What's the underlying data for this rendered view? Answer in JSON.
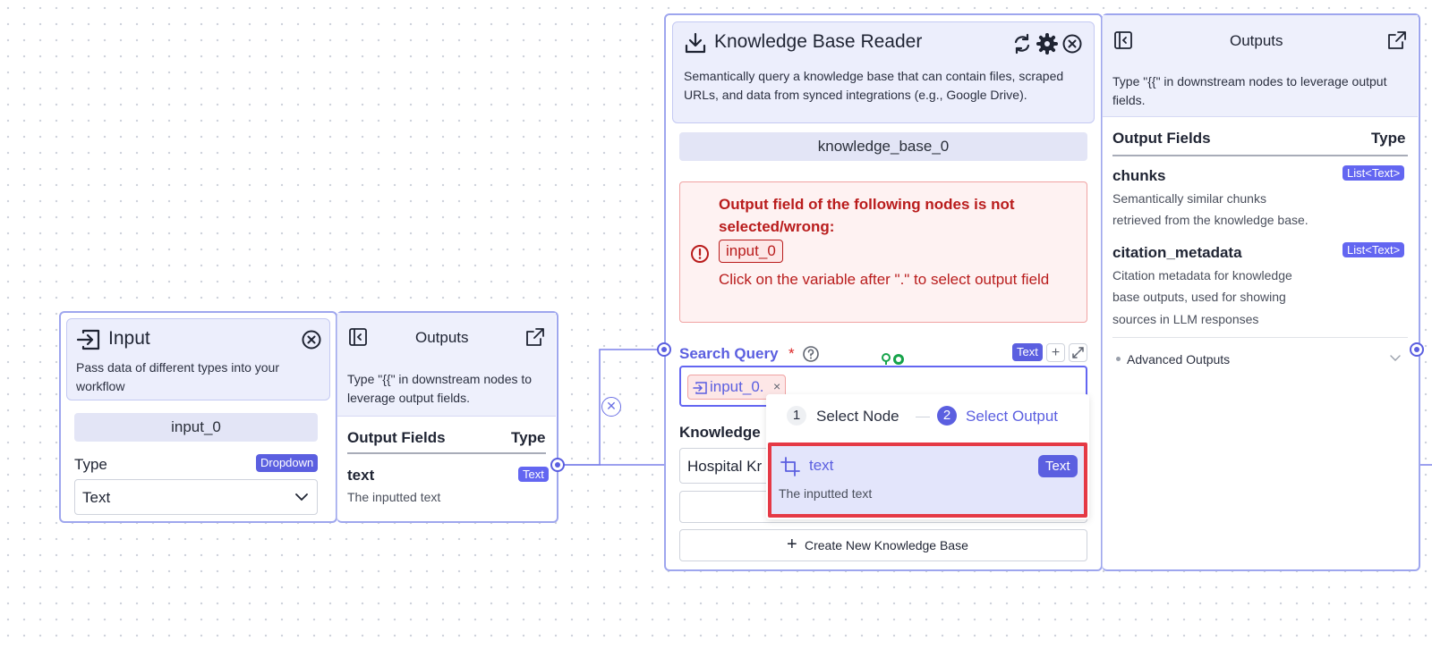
{
  "input_node": {
    "title": "Input",
    "description": "Pass data of different types into your workflow",
    "name": "input_0",
    "type_label": "Type",
    "type_badge": "Dropdown",
    "type_value": "Text"
  },
  "input_outputs": {
    "title": "Outputs",
    "description": "Type \"{{\" in downstream nodes to leverage output fields.",
    "fields_header": "Output Fields",
    "type_header": "Type",
    "fields": [
      {
        "name": "text",
        "type": "Text",
        "description": "The inputted text"
      }
    ]
  },
  "kb_node": {
    "title": "Knowledge Base Reader",
    "description": "Semantically query a knowledge base that can contain files, scraped URLs, and data from synced integrations (e.g., Google Drive).",
    "name": "knowledge_base_0",
    "error": {
      "title": "Output field of the following nodes is not selected/wrong:",
      "chip": "input_0",
      "hint": "Click on the variable after \".\" to select output field"
    },
    "search_query": {
      "label": "Search Query",
      "required_mark": "*",
      "type_badge": "Text",
      "chip": "input_0.",
      "chip_remove": "×"
    },
    "knowledge_label": "Knowledge",
    "knowledge_value": "Hospital Kr",
    "create_button": "Create New Knowledge Base"
  },
  "dropdown": {
    "step1_num": "1",
    "step1_label": "Select Node",
    "step2_num": "2",
    "step2_label": "Select Output",
    "option": {
      "name": "text",
      "type": "Text",
      "description": "The inputted text"
    }
  },
  "kb_outputs": {
    "title": "Outputs",
    "description": "Type \"{{\" in downstream nodes to leverage output fields.",
    "fields_header": "Output Fields",
    "type_header": "Type",
    "fields": [
      {
        "name": "chunks",
        "type": "List<Text>",
        "desc1": "Semantically similar chunks",
        "desc2": "retrieved from the knowledge base."
      },
      {
        "name": "citation_metadata",
        "type": "List<Text>",
        "desc1": "Citation metadata for knowledge",
        "desc2": "base outputs, used for showing",
        "desc3": "sources in LLM responses"
      }
    ],
    "advanced": "Advanced Outputs"
  },
  "colors": {
    "accent": "#5b5fe0",
    "edge": "#7b80ea",
    "error_text": "#b91c1c",
    "error_bg": "#fef2f2",
    "highlight": "#e53945"
  }
}
